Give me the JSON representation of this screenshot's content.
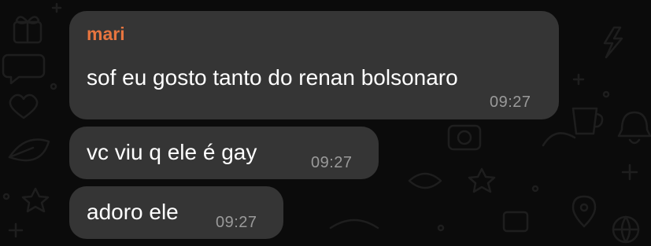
{
  "chat": {
    "messages": [
      {
        "sender": "mari",
        "text": "sof eu gosto tanto do renan bolsonaro",
        "time": "09:27"
      },
      {
        "text": "vc viu q ele é gay",
        "time": "09:27"
      },
      {
        "text": "adoro ele",
        "time": "09:27"
      }
    ]
  },
  "colors": {
    "background": "#0b0b0b",
    "bubble": "#353535",
    "sender_name": "#e8753f",
    "message_text": "#ffffff",
    "timestamp": "#9a9a9a",
    "wallpaper_doodle": "#1e1e1e"
  },
  "wallpaper": {
    "icons": [
      "gift-icon",
      "chat-bubble-icon",
      "heart-icon",
      "lightning-icon",
      "bell-icon",
      "star-icon",
      "camera-icon",
      "map-pin-icon",
      "cup-icon",
      "ball-icon",
      "leaf-icon",
      "sparkle-icon"
    ]
  }
}
